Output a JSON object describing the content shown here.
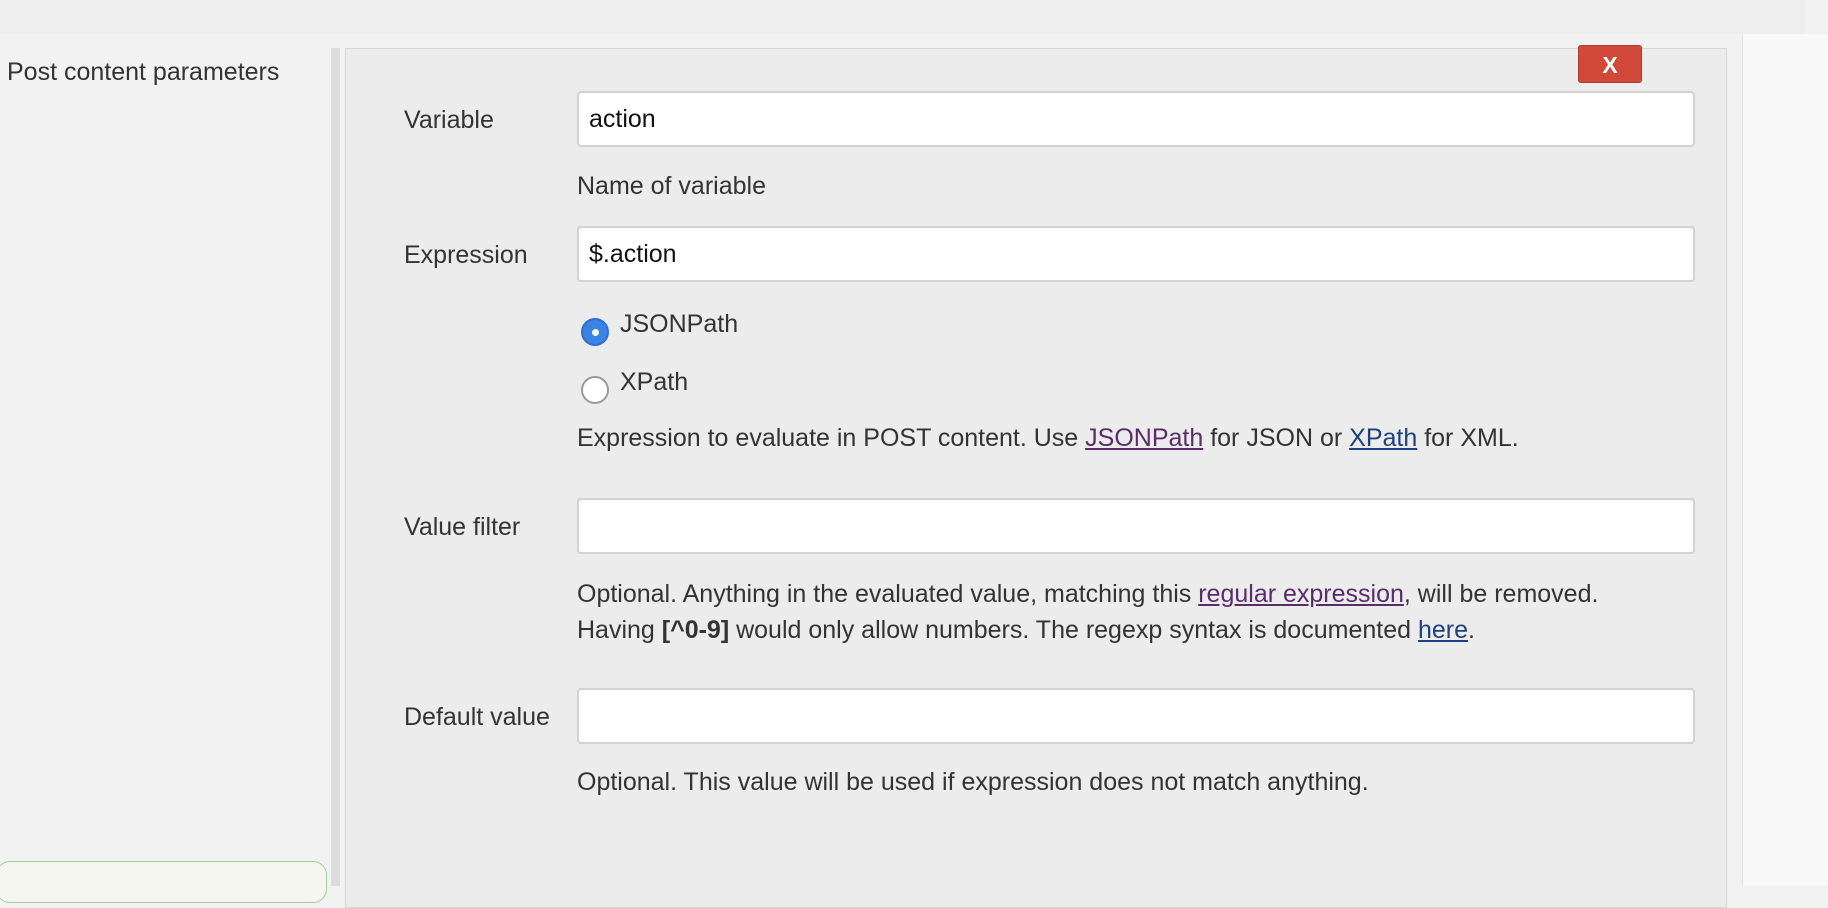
{
  "section": {
    "label": "Post content parameters"
  },
  "delete_button": {
    "label": "X"
  },
  "fields": {
    "variable": {
      "label": "Variable",
      "value": "action",
      "help": "Name of variable"
    },
    "expression": {
      "label": "Expression",
      "value": "$.action",
      "options": [
        {
          "label": "JSONPath",
          "selected": true
        },
        {
          "label": "XPath",
          "selected": false
        }
      ],
      "help": {
        "prefix": "Expression to evaluate in POST content. Use ",
        "link1": "JSONPath",
        "mid": " for JSON or ",
        "link2": "XPath",
        "suffix": " for XML."
      }
    },
    "value_filter": {
      "label": "Value filter",
      "value": "",
      "help": {
        "line1_prefix": "Optional. Anything in the evaluated value, matching this ",
        "line1_link": "regular expression",
        "line1_suffix": ", will be removed.",
        "line2_prefix": "Having ",
        "line2_bold": "[^0-9]",
        "line2_mid": " would only allow numbers. The regexp syntax is documented ",
        "line2_link": "here",
        "line2_suffix": "."
      }
    },
    "default_value": {
      "label": "Default value",
      "value": "",
      "help": "Optional. This value will be used if expression does not match anything."
    }
  },
  "colors": {
    "delete": "#d24939",
    "radio_selected": "#3b82e6",
    "link": "#1e3f80",
    "link_visited": "#5a2d6a"
  }
}
